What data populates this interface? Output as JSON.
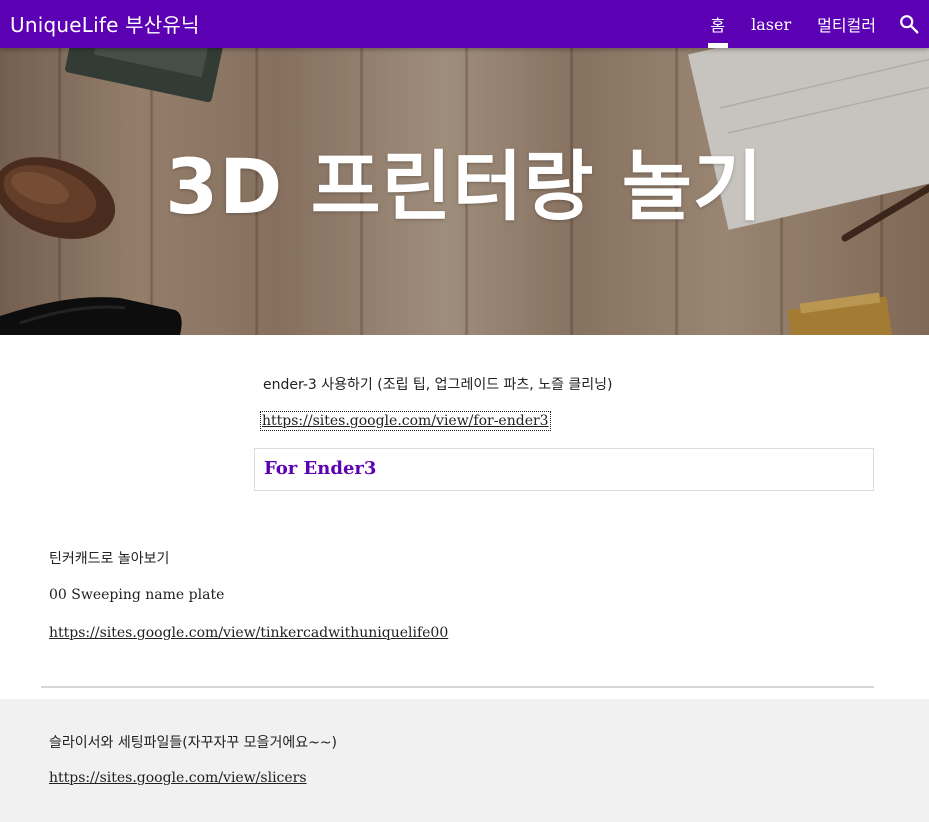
{
  "header": {
    "site_title": "UniqueLife 부산유닉",
    "nav": [
      {
        "label": "홈",
        "active": true
      },
      {
        "label": "laser",
        "active": false
      },
      {
        "label": "멀티컬러",
        "active": false
      }
    ],
    "search_icon": "search-icon",
    "accent_color": "#5c00b3"
  },
  "hero": {
    "title": "3D 프린터랑 놀기"
  },
  "ender_section": {
    "description": "ender-3 사용하기 (조립 팁, 업그레이드 파츠, 노즐 클리닝)",
    "link": "https://sites.google.com/view/for-ender3",
    "card_title": "For Ender3"
  },
  "tinkercad_section": {
    "heading": "틴커캐드로 놀아보기",
    "item": "00 Sweeping name plate",
    "link": "https://sites.google.com/view/tinkercadwithuniquelife00"
  },
  "slicer_section": {
    "heading": "슬라이서와 세팅파일들(자꾸자꾸 모을거에요~~)",
    "link": "https://sites.google.com/view/slicers"
  }
}
